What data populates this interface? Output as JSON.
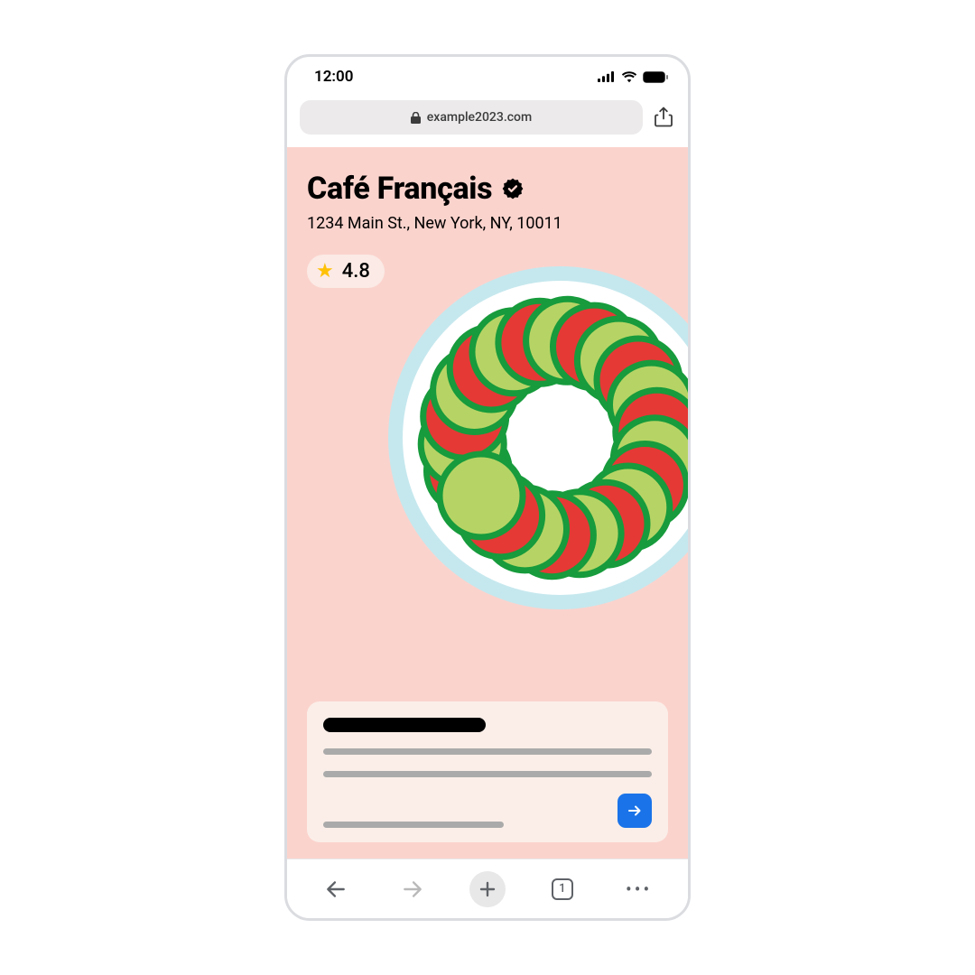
{
  "status": {
    "time": "12:00"
  },
  "browser": {
    "url": "example2023.com",
    "tab_count": "1"
  },
  "restaurant": {
    "name": "Café Français",
    "address": "1234 Main St., New York, NY, 10011",
    "rating": "4.8"
  }
}
